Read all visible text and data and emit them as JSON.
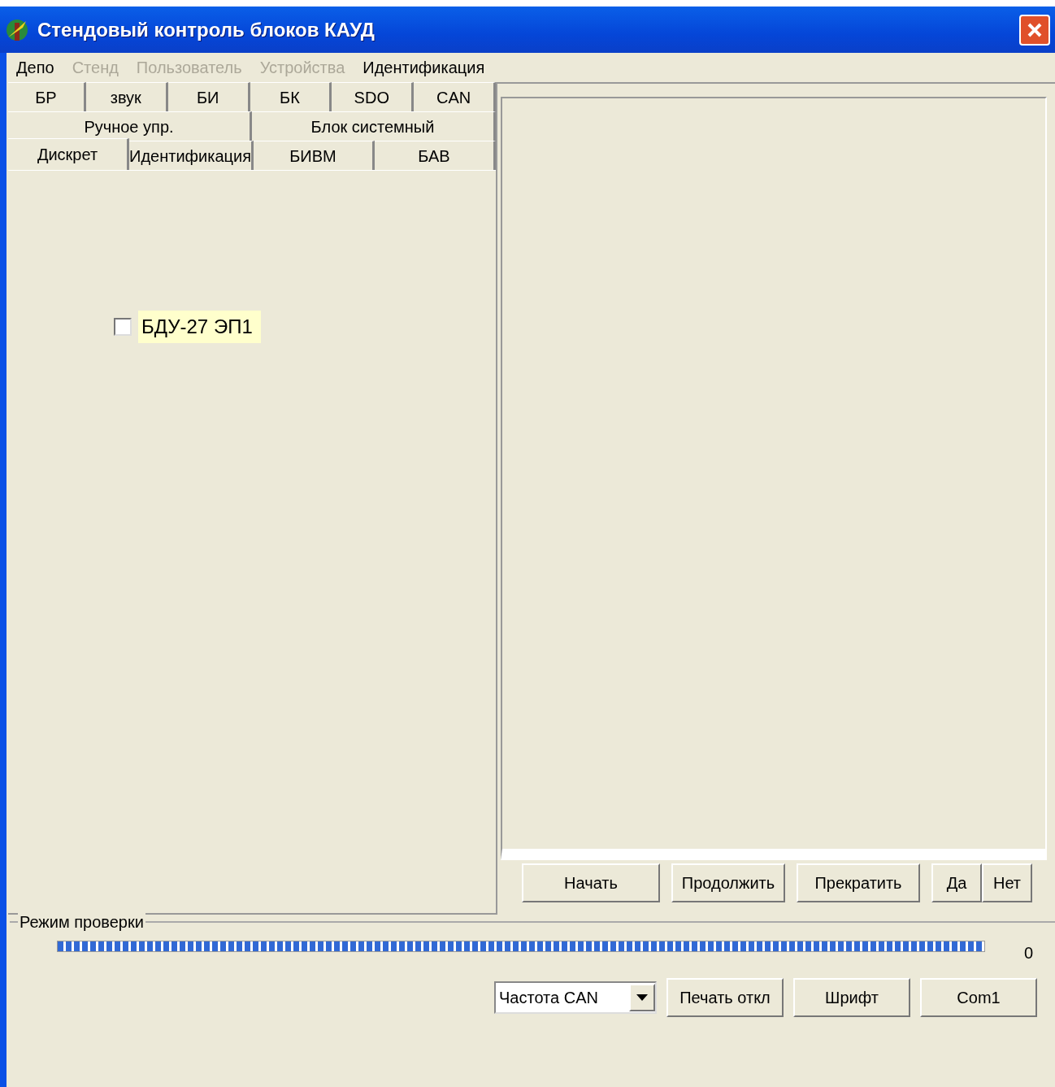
{
  "window": {
    "title": "Стендовый контроль блоков КАУД"
  },
  "menu": [
    {
      "label": "Депо",
      "disabled": false
    },
    {
      "label": "Стенд",
      "disabled": true
    },
    {
      "label": "Пользователь",
      "disabled": true
    },
    {
      "label": "Устройства",
      "disabled": true
    },
    {
      "label": "Идентификация",
      "disabled": false
    }
  ],
  "tab_rows": [
    [
      {
        "label": "БР",
        "selected": false
      },
      {
        "label": "звук",
        "selected": false
      },
      {
        "label": "БИ",
        "selected": false
      },
      {
        "label": "БК",
        "selected": false
      },
      {
        "label": "SDO",
        "selected": false
      },
      {
        "label": "CAN",
        "selected": false
      }
    ],
    [
      {
        "label": "Ручное упр.",
        "selected": false
      },
      {
        "label": "Блок системный",
        "selected": false
      }
    ],
    [
      {
        "label": "Дискрет",
        "selected": true
      },
      {
        "label": "Идентификация",
        "selected": false
      },
      {
        "label": "БИВМ",
        "selected": false
      },
      {
        "label": "БАВ",
        "selected": false
      }
    ]
  ],
  "checkbox": {
    "label": "БДУ-27 ЭП1",
    "checked": false
  },
  "action_buttons": [
    "Начать",
    "Продолжить",
    "Прекратить",
    "Да",
    "Нет"
  ],
  "group": {
    "title": "Режим проверки",
    "progress": {
      "level": 1
    },
    "count": "0"
  },
  "combo": {
    "value": "Частота CAN"
  },
  "bottom_buttons": [
    "Печать откл",
    "Шрифт",
    "Com1"
  ]
}
